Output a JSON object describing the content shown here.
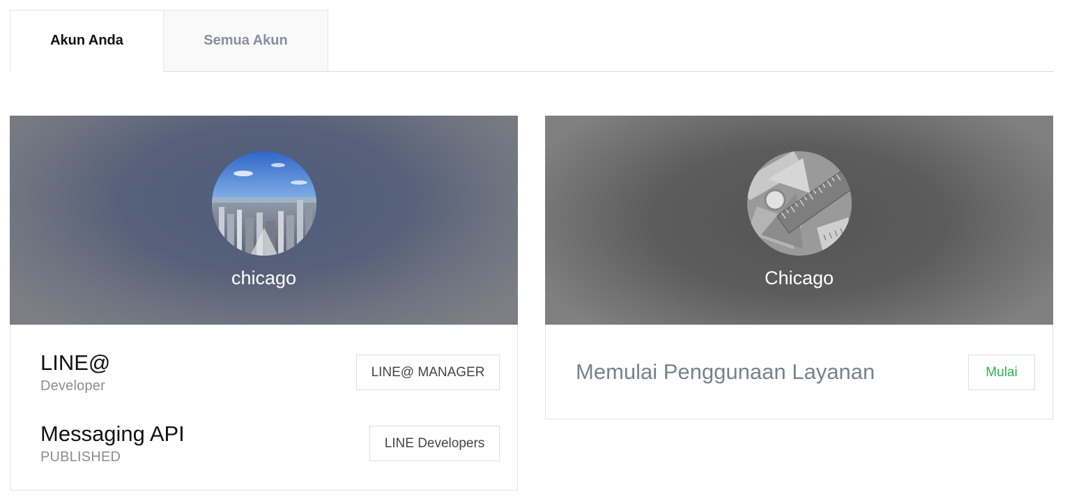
{
  "tabs": [
    {
      "label": "Akun Anda",
      "active": true
    },
    {
      "label": "Semua Akun",
      "active": false
    }
  ],
  "cards": [
    {
      "account_name": "chicago",
      "avatar_icon": "city-skyline-photo",
      "services": [
        {
          "title": "LINE@",
          "subtitle": "Developer",
          "button_label": "LINE@ MANAGER"
        },
        {
          "title": "Messaging API",
          "subtitle": "PUBLISHED",
          "button_label": "LINE Developers"
        }
      ]
    },
    {
      "account_name": "Chicago",
      "avatar_icon": "rulers-photo",
      "start_title": "Memulai Penggunaan Layanan",
      "start_button_label": "Mulai"
    }
  ],
  "colors": {
    "accent_green": "#28b34a",
    "tab_inactive_text": "#8a8ea0",
    "banner_blue": "#56607a",
    "banner_gray": "#5c5c5c"
  }
}
